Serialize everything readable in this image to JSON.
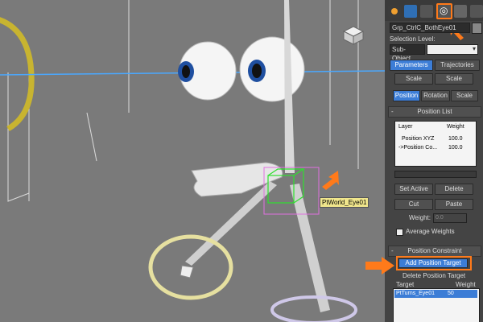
{
  "viewport": {
    "object_label": "PtWorld_Eye01"
  },
  "panel": {
    "tabs": [
      {
        "name": "create"
      },
      {
        "name": "modify"
      },
      {
        "name": "hierarchy"
      },
      {
        "name": "motion"
      },
      {
        "name": "display"
      },
      {
        "name": "utilities"
      }
    ],
    "object_name": "Grp_CtrlC_BothEye01",
    "selection_level_label": "Selection Level:",
    "sub_object_label": "Sub-Object",
    "parameters_button": "Parameters",
    "trajectories_button": "Trajectories",
    "top_buttons": [
      "Scale",
      "Scale"
    ],
    "pos_buttons": [
      "Position",
      "Rotation",
      "Scale"
    ],
    "position_list": {
      "title": "Position List",
      "columns": [
        "Layer",
        "Weight"
      ],
      "rows": [
        {
          "layer": "Position XYZ",
          "weight": "100.0"
        },
        {
          "layer": "->Position Co...",
          "weight": "100.0"
        }
      ]
    },
    "set_active": "Set Active",
    "delete": "Delete",
    "cut": "Cut",
    "paste": "Paste",
    "weight_label": "Weight:",
    "weight_value": "0.0",
    "average_weights_label": "Average Weights",
    "position_constraint": {
      "title": "Position Constraint",
      "add_target": "Add Position Target",
      "delete_target": "Delete Position Target",
      "columns": [
        "Target",
        "Weight"
      ],
      "rows": [
        {
          "target": "PtTurns_Eye01",
          "weight": "50"
        }
      ]
    }
  },
  "colors": {
    "highlight_orange": "#ff7a1a",
    "accent_blue": "#3c7dd6",
    "label_yellow": "#f0e68c"
  }
}
